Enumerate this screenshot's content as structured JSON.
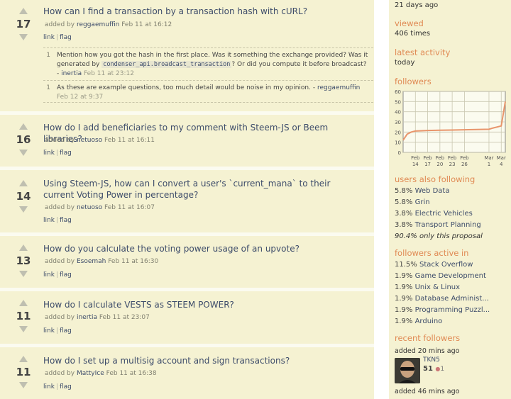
{
  "questions": [
    {
      "score": "17",
      "title": "How can I find a transaction by a transaction hash with cURL?",
      "added_by": "added by",
      "user": "reggaemuffin",
      "date": "Feb 11 at 16:12",
      "link": "link",
      "flag": "flag"
    },
    {
      "score": "16",
      "title": "How do I add beneficiaries to my comment with Steem-JS or Beem libraries?",
      "added_by": "added by",
      "user": "netuoso",
      "date": "Feb 11 at 16:11",
      "link": "link",
      "flag": "flag"
    },
    {
      "score": "14",
      "title": "Using Steem-JS, how can I convert a user's `current_mana` to their current Voting Power in percentage?",
      "added_by": "added by",
      "user": "netuoso",
      "date": "Feb 11 at 16:07",
      "link": "link",
      "flag": "flag"
    },
    {
      "score": "13",
      "title": "How do you calculate the voting power usage of an upvote?",
      "added_by": "added by",
      "user": "Esoemah",
      "date": "Feb 11 at 16:30",
      "link": "link",
      "flag": "flag"
    },
    {
      "score": "11",
      "title": "How do I calculate VESTS as STEEM POWER?",
      "added_by": "added by",
      "user": "inertia",
      "date": "Feb 11 at 23:07",
      "link": "link",
      "flag": "flag"
    },
    {
      "score": "11",
      "title": "How do I set up a multisig account and sign transactions?",
      "added_by": "added by",
      "user": "MattyIce",
      "date": "Feb 11 at 16:38",
      "link": "link",
      "flag": "flag"
    }
  ],
  "comments": [
    {
      "num": "1",
      "text_before": "Mention how you got the hash in the first place. Was it something the exchange provided? Was it generated by",
      "code": "condenser_api.broadcast_transaction",
      "text_after": "? Or did you compute it before broadcast? -",
      "user": "inertia",
      "date": "Feb 11 at 23:12"
    },
    {
      "num": "1",
      "text_before": "As these are example questions, too much detail would be noise in my opinion. -",
      "code": "",
      "text_after": "",
      "user": "reggaemuffin",
      "date": "Feb 12 at 9:37"
    }
  ],
  "sidebar": {
    "asked_ago": "21 days ago",
    "viewed_label": "viewed",
    "viewed_value": "406 times",
    "latest_activity_label": "latest activity",
    "latest_activity_value": "today",
    "followers_label": "followers",
    "also_following_label": "users also following",
    "also_following": [
      {
        "pct": "5.8%",
        "name": "Web Data"
      },
      {
        "pct": "5.8%",
        "name": "Grin"
      },
      {
        "pct": "3.8%",
        "name": "Electric Vehicles"
      },
      {
        "pct": "3.8%",
        "name": "Transport Planning"
      }
    ],
    "only_this": "90.4% only this proposal",
    "active_in_label": "followers active in",
    "active_in": [
      {
        "pct": "11.5%",
        "name": "Stack Overflow"
      },
      {
        "pct": "1.9%",
        "name": "Game Development"
      },
      {
        "pct": "1.9%",
        "name": "Unix & Linux"
      },
      {
        "pct": "1.9%",
        "name": "Database Administ..."
      },
      {
        "pct": "1.9%",
        "name": "Programming Puzzl..."
      },
      {
        "pct": "1.9%",
        "name": "Arduino"
      }
    ],
    "recent_followers_label": "recent followers",
    "recent": [
      {
        "added": "added 20 mins ago",
        "name": "TKN5",
        "rep": "51",
        "badge": "1"
      },
      {
        "added": "added 46 mins ago"
      }
    ]
  },
  "chart_data": {
    "type": "line",
    "x_tick_labels": [
      "Feb 14",
      "Feb 17",
      "Feb 20",
      "Feb 23",
      "Feb 26",
      "Mar 1",
      "Mar 4"
    ],
    "ylim": [
      0,
      60
    ],
    "y_ticks": [
      0,
      10,
      20,
      30,
      40,
      50,
      60
    ],
    "grid": true,
    "x": [
      "Feb 11",
      "Feb 12",
      "Feb 13",
      "Feb 14",
      "Feb 17",
      "Feb 20",
      "Feb 23",
      "Feb 26",
      "Mar 1",
      "Mar 2",
      "Mar 3",
      "Mar 4",
      "Mar 5"
    ],
    "values": [
      12,
      18,
      20,
      21,
      21.5,
      21.8,
      22,
      22.2,
      22.8,
      24,
      25,
      26,
      50
    ],
    "line_color": "#e8956b"
  }
}
